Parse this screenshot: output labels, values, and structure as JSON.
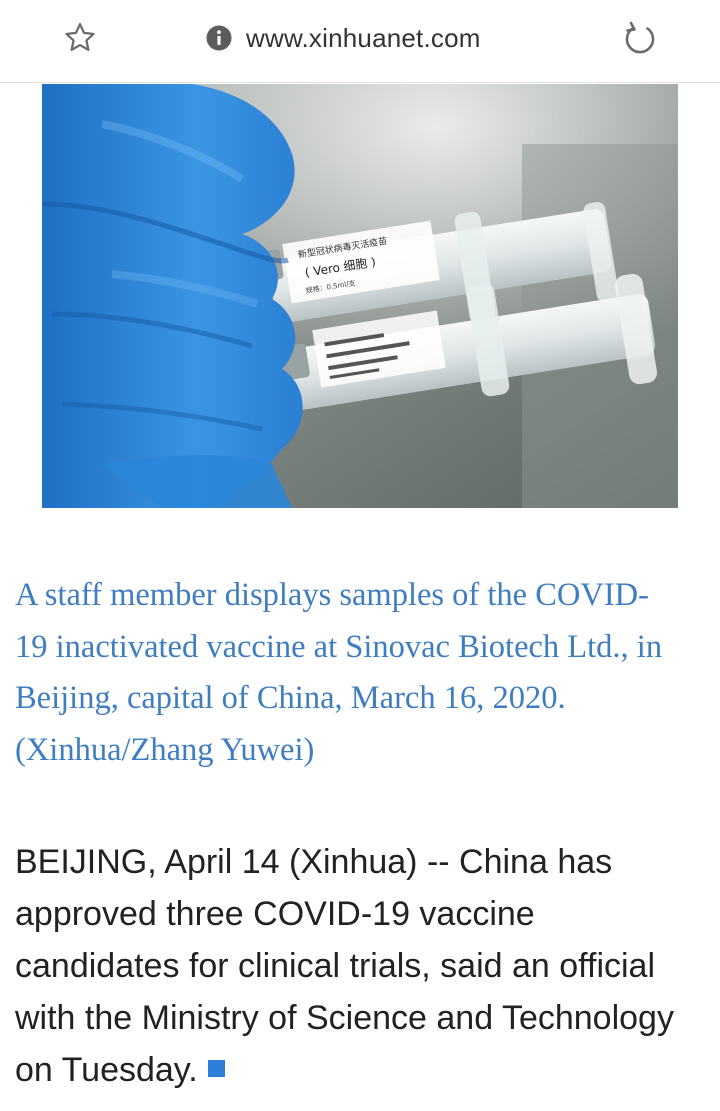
{
  "browser": {
    "url": "www.xinhuanet.com"
  },
  "article": {
    "image_alt": "Vaccine syringes held in blue gloved hands",
    "vial_label_line1": "新型冠状病毒灭活疫苗",
    "vial_label_line2": "( Vero 细胞 )",
    "vial_label_line3": "规格：0.5ml/支",
    "caption": "A staff member displays samples of the COVID-19 inactivated vaccine at Sinovac Biotech Ltd., in Beijing, capital of China, March 16, 2020. (Xinhua/Zhang Yuwei)",
    "body": "BEIJING, April 14 (Xinhua) -- China has approved three COVID-19 vaccine candidates for clinical trials, said an official with the Ministry of Science and Technology on Tuesday."
  },
  "colors": {
    "caption": "#3f7dc2",
    "body": "#222222",
    "end_marker": "#2e7fd9",
    "glove": "#2f86d6"
  },
  "icons": {
    "bookmark": "star-icon",
    "site_info": "info-icon",
    "reload": "reload-icon",
    "end_marker": "end-square-icon"
  }
}
